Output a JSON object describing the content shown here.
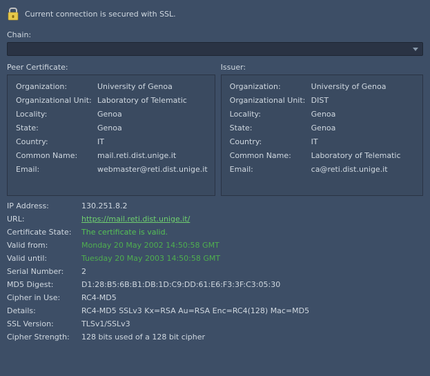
{
  "header": {
    "status_text": "Current connection is secured with SSL."
  },
  "chain": {
    "label": "Chain:",
    "selected": ""
  },
  "peer": {
    "title": "Peer Certificate:",
    "rows": {
      "org_label": "Organization:",
      "org_value": "University of Genoa",
      "ou_label": "Organizational Unit:",
      "ou_value": "Laboratory of Telematic",
      "loc_label": "Locality:",
      "loc_value": "Genoa",
      "state_label": "State:",
      "state_value": "Genoa",
      "country_label": "Country:",
      "country_value": "IT",
      "cn_label": "Common Name:",
      "cn_value": "mail.reti.dist.unige.it",
      "email_label": "Email:",
      "email_value": "webmaster@reti.dist.unige.it"
    }
  },
  "issuer": {
    "title": "Issuer:",
    "rows": {
      "org_label": "Organization:",
      "org_value": "University of Genoa",
      "ou_label": "Organizational Unit:",
      "ou_value": "DIST",
      "loc_label": "Locality:",
      "loc_value": "Genoa",
      "state_label": "State:",
      "state_value": "Genoa",
      "country_label": "Country:",
      "country_value": "IT",
      "cn_label": "Common Name:",
      "cn_value": "Laboratory of Telematic",
      "email_label": "Email:",
      "email_value": "ca@reti.dist.unige.it"
    }
  },
  "details": {
    "ip_label": "IP Address:",
    "ip_value": "130.251.8.2",
    "url_label": "URL:",
    "url_value": "https://mail.reti.dist.unige.it/",
    "cert_state_label": "Certificate State:",
    "cert_state_value": "The certificate is valid.",
    "valid_from_label": "Valid from:",
    "valid_from_value": "Monday 20 May 2002 14:50:58 GMT",
    "valid_until_label": "Valid until:",
    "valid_until_value": "Tuesday 20 May 2003 14:50:58 GMT",
    "serial_label": "Serial Number:",
    "serial_value": "2",
    "md5_label": "MD5 Digest:",
    "md5_value": "D1:28:B5:6B:B1:DB:1D:C9:DD:61:E6:F3:3F:C3:05:30",
    "cipher_label": "Cipher in Use:",
    "cipher_value": "RC4-MD5",
    "details_label": "Details:",
    "details_value": "RC4-MD5 SSLv3 Kx=RSA Au=RSA Enc=RC4(128) Mac=MD5",
    "sslver_label": "SSL Version:",
    "sslver_value": "TLSv1/SSLv3",
    "strength_label": "Cipher Strength:",
    "strength_value": "128 bits used of a 128 bit cipher"
  }
}
